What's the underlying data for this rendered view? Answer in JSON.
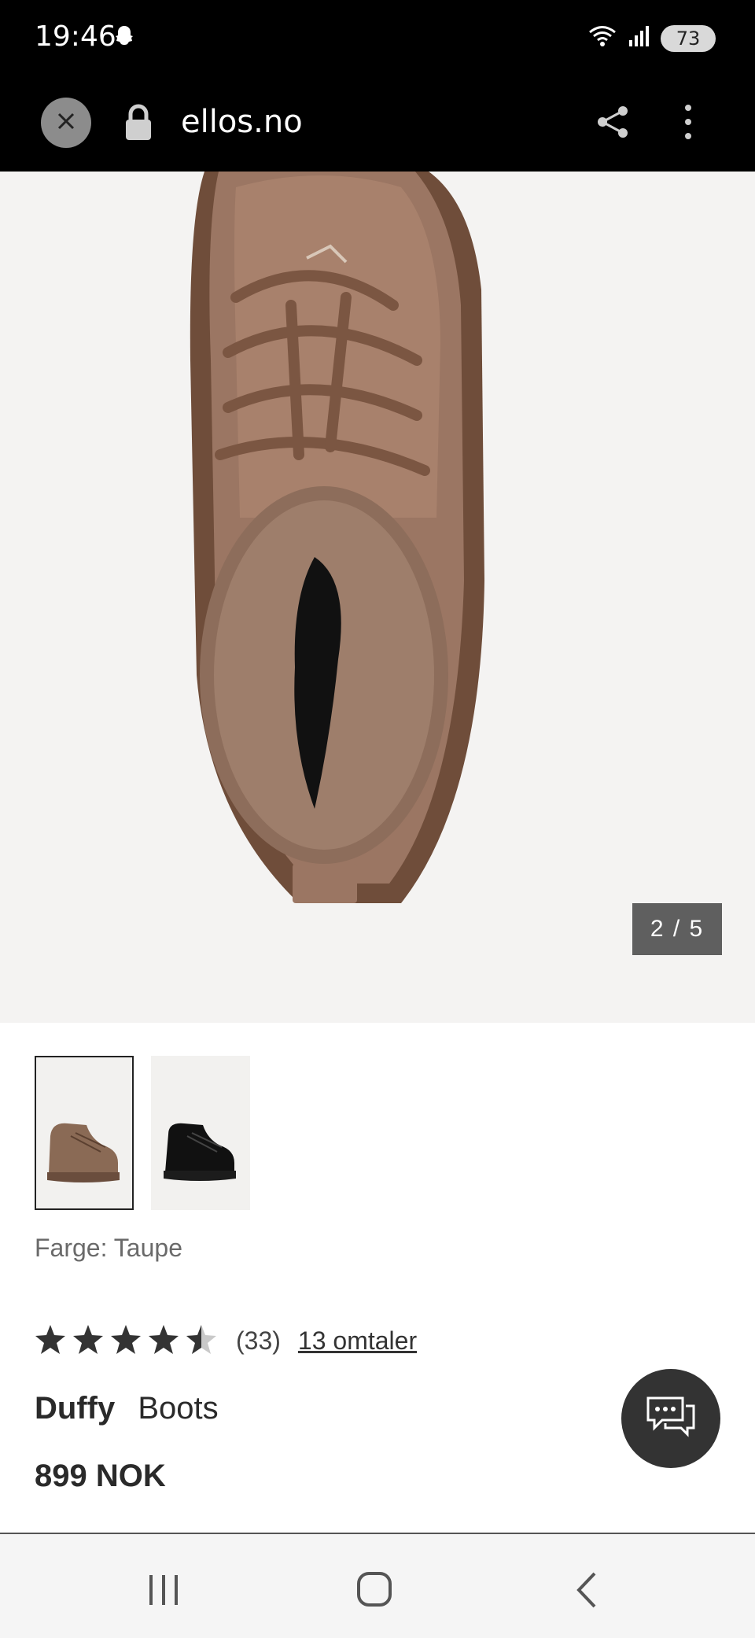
{
  "status_bar": {
    "time": "19:46",
    "battery": "73",
    "icons": [
      "snapchat-icon",
      "wifi-icon",
      "signal-icon",
      "battery-icon"
    ]
  },
  "browser": {
    "url": "ellos.no",
    "icons": [
      "close-icon",
      "lock-icon",
      "share-icon",
      "more-vertical-icon"
    ]
  },
  "gallery": {
    "counter": "2 / 5",
    "thumbnails": [
      "taupe-boot",
      "black-boot"
    ]
  },
  "product": {
    "color_label": "Farge: Taupe",
    "rating": 4.5,
    "rating_count": "(33)",
    "reviews_link": "13 omtaler",
    "brand": "Duffy",
    "name": "Boots",
    "price": "899 NOK"
  },
  "colors": {
    "accent_dark": "#333333",
    "boot_taupe": "#8a6a55",
    "boot_black": "#111111"
  },
  "nav_icons": [
    "recent-apps-icon",
    "home-icon",
    "back-icon"
  ]
}
